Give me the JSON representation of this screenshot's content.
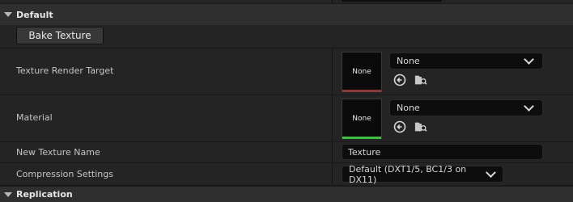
{
  "categories": {
    "default_label": "Default",
    "replication_label": "Replication"
  },
  "bake_button_label": "Bake Texture",
  "properties": {
    "texture_render_target": {
      "label": "Texture Render Target",
      "thumbnail_text": "None",
      "value": "None",
      "thumbnail_accent": "#8a3a3a"
    },
    "material": {
      "label": "Material",
      "thumbnail_text": "None",
      "value": "None",
      "thumbnail_accent": "#3fbf3f"
    },
    "new_texture_name": {
      "label": "New Texture Name",
      "value": "Texture"
    },
    "compression_settings": {
      "label": "Compression Settings",
      "value": "Default (DXT1/5, BC1/3 on DX11)"
    }
  },
  "icons": {
    "use_selected": "arrow-left-circle-icon",
    "browse": "folder-search-icon"
  },
  "colors": {
    "background": "#1a1a1a",
    "row": "#242424",
    "header": "#2f2f2f"
  }
}
